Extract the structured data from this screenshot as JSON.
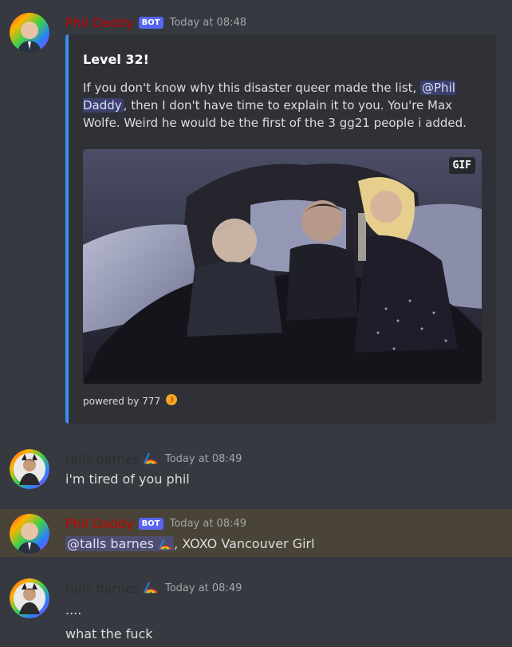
{
  "messages": [
    {
      "username": "Phil Daddy",
      "bot_tag": "BOT",
      "timestamp": "Today at 08:48",
      "embed": {
        "title": "Level 32!",
        "desc_part1": "If you don't know why this disaster queer made the list,",
        "mention": "@Phil Daddy",
        "desc_part2": ", then I don't have time to explain it to you. You're Max Wolfe. Weird he would be the first of the 3 gg21 people i added.",
        "gif_badge": "GIF",
        "footer": "powered by 777"
      }
    },
    {
      "username": "talls barnes",
      "timestamp": "Today at 08:49",
      "text": "i'm tired of you phil"
    },
    {
      "username": "Phil Daddy",
      "bot_tag": "BOT",
      "timestamp": "Today at 08:49",
      "mention": "@talls barnes",
      "text": ", XOXO Vancouver Girl"
    },
    {
      "username": "talls barnes",
      "timestamp": "Today at 08:49",
      "line1": "....",
      "line2": "what the fuck"
    }
  ],
  "colors": {
    "background": "#36393f",
    "embed_bg": "#2f3136",
    "embed_accent": "#3b8ef2",
    "bot_name": "#c70000",
    "bot_tag": "#5865f2",
    "mention_bg": "#414775",
    "highlight": "#4a4337"
  },
  "icons": [
    "rainbow-flag-icon",
    "fire-icon"
  ]
}
